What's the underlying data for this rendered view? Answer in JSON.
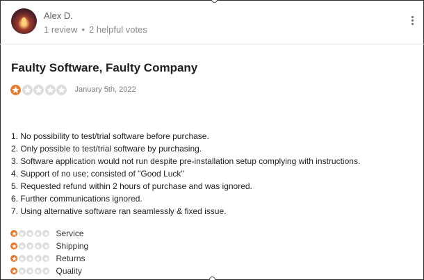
{
  "reviewer": {
    "name": "Alex D.",
    "reviews": "1 review",
    "separator": "•",
    "votes": "2 helpful votes",
    "avatar_icon": "candle-avatar"
  },
  "menu_icon": "more-vertical-icon",
  "review": {
    "title": "Faulty Software, Faulty Company",
    "rating": 1,
    "rating_max": 5,
    "date": "January 5th, 2022",
    "lines": [
      "1. No possibility to test/trial software before purchase.",
      "2. Only possible to test/trial software by purchasing.",
      "3. Software application would not run despite pre-installation setup complying with instructions.",
      "4. Support of no use; consisted of \"Good Luck\"",
      "5. Requested refund within 2 hours of purchase and was ignored.",
      "6. Further communications ignored.",
      "7. Using alternative software ran seamlessly & fixed issue."
    ]
  },
  "sub_ratings": [
    {
      "label": "Service",
      "rating": 1
    },
    {
      "label": "Shipping",
      "rating": 1
    },
    {
      "label": "Returns",
      "rating": 1
    },
    {
      "label": "Quality",
      "rating": 1
    }
  ],
  "colors": {
    "star_filled": "#e8792b",
    "star_empty": "#dcdcdc"
  }
}
